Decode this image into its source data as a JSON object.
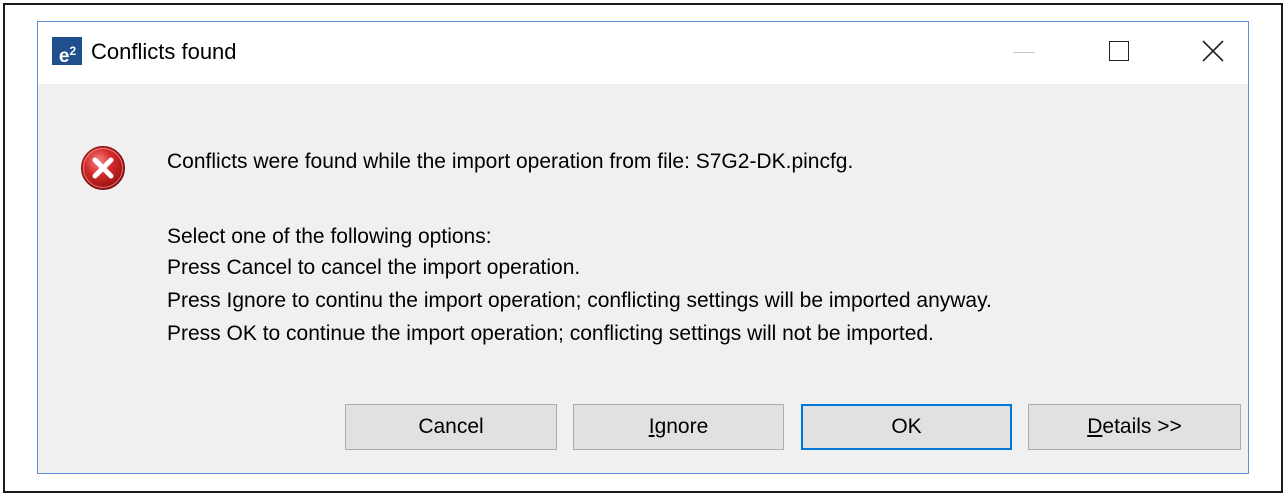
{
  "window": {
    "app_icon_text": "e",
    "app_icon_sup": "2",
    "title": "Conflicts found",
    "minimize_icon": "minimize-icon",
    "maximize_icon": "maximize-icon",
    "close_icon": "close-icon"
  },
  "message": {
    "icon": "error-icon",
    "line1": "Conflicts were found while the import operation  from file: S7G2-DK.pincfg.",
    "line2": "Select one of the following options:",
    "line3": "Press Cancel to cancel the import operation.",
    "line4": "Press Ignore to continu the import operation; conflicting settings will be imported anyway.",
    "line5": "Press OK to continue the import operation; conflicting settings will not be imported."
  },
  "buttons": {
    "cancel": "Cancel",
    "ignore_mnemonic": "I",
    "ignore_rest": "gnore",
    "ok": "OK",
    "details_mnemonic": "D",
    "details_rest": "etails >>"
  },
  "colors": {
    "dialog_border": "#5b8fd1",
    "dialog_bg": "#f0f0f0",
    "app_icon_bg": "#1f4f8c",
    "default_button_border": "#0078d7",
    "error_red": "#d42a2a"
  }
}
